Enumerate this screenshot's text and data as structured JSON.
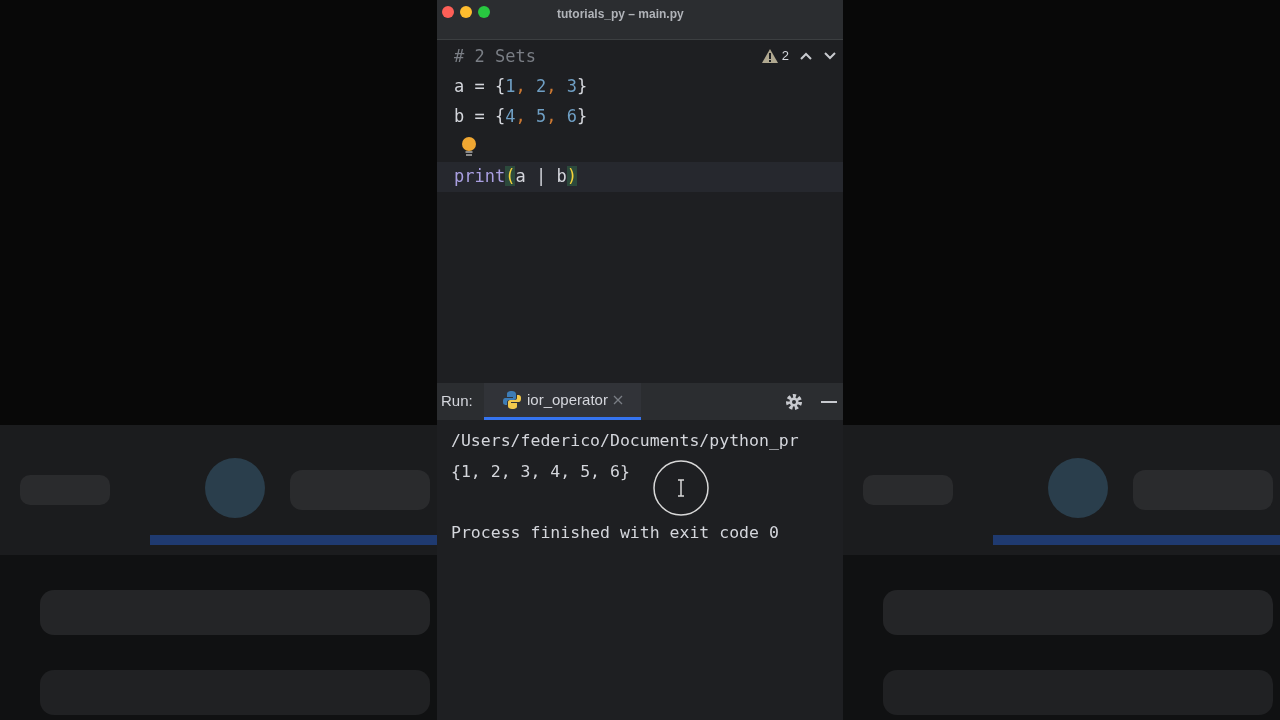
{
  "window": {
    "title": "tutorials_py – main.py"
  },
  "editor": {
    "warnings": "2",
    "lines": [
      {
        "kind": "code",
        "current": false,
        "tokens": [
          {
            "text": "# 2 Sets",
            "kind": "comment"
          }
        ]
      },
      {
        "kind": "code",
        "current": false,
        "tokens": [
          {
            "text": "a = {",
            "kind": "plain"
          },
          {
            "text": "1",
            "kind": "number"
          },
          {
            "text": ", ",
            "kind": "comma"
          },
          {
            "text": "2",
            "kind": "number"
          },
          {
            "text": ", ",
            "kind": "comma"
          },
          {
            "text": "3",
            "kind": "number"
          },
          {
            "text": "}",
            "kind": "plain"
          }
        ]
      },
      {
        "kind": "code",
        "current": false,
        "tokens": [
          {
            "text": "b = {",
            "kind": "plain"
          },
          {
            "text": "4",
            "kind": "number"
          },
          {
            "text": ", ",
            "kind": "comma"
          },
          {
            "text": "5",
            "kind": "number"
          },
          {
            "text": ", ",
            "kind": "comma"
          },
          {
            "text": "6",
            "kind": "number"
          },
          {
            "text": "}",
            "kind": "plain"
          }
        ]
      },
      {
        "kind": "bulb",
        "current": false
      },
      {
        "kind": "code",
        "current": true,
        "tokens": [
          {
            "text": "print",
            "kind": "func"
          },
          {
            "text": "(",
            "kind": "paren"
          },
          {
            "text": "a | b",
            "kind": "plain"
          },
          {
            "text": ")",
            "kind": "paren"
          }
        ]
      }
    ]
  },
  "run": {
    "label": "Run:",
    "tabs": [
      {
        "label": "ior_operator",
        "selected": true
      }
    ],
    "output": [
      {
        "kind": "stdout",
        "text": "/Users/federico/Documents/python_pr"
      },
      {
        "kind": "stdout",
        "text": "{1, 2, 3, 4, 5, 6}"
      },
      {
        "kind": "exit",
        "text": "Process finished with exit code 0"
      }
    ]
  }
}
